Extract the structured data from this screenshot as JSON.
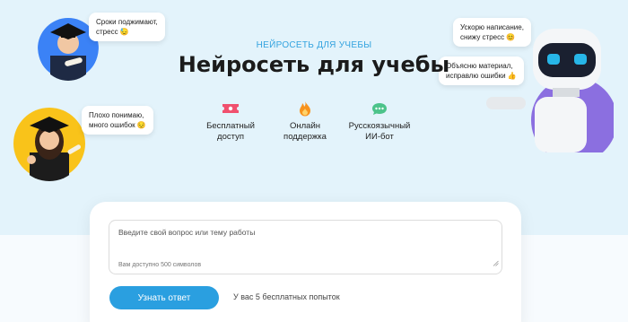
{
  "hero": {
    "eyebrow": "НЕЙРОСЕТЬ ДЛЯ УЧЕБЫ",
    "title": "Нейросеть для учебы"
  },
  "features": [
    {
      "icon": "ticket-icon",
      "label": "Бесплатный\nдоступ",
      "color": "#f0506e"
    },
    {
      "icon": "flame-icon",
      "label": "Онлайн\nподдержка",
      "color": "#f7931e"
    },
    {
      "icon": "chat-icon",
      "label": "Русскоязычный\nИИ-бот",
      "color": "#4cc38a"
    }
  ],
  "bubbles": {
    "student_male": "Сроки поджимают,\nстресс 😓",
    "student_female": "Плохо понимаю,\nмного ошибок 😔",
    "robot_top": "Ускорю написание,\nснижу стресс 😊",
    "robot_bottom": "Объясню материал,\nисправлю ошибки 👍"
  },
  "form": {
    "placeholder": "Введите свой вопрос или тему работы",
    "hint": "Вам доступно 500 символов",
    "submit_label": "Узнать ответ",
    "tries_text": "У вас 5 бесплатных попыток"
  },
  "colors": {
    "accent": "#2a9fe0",
    "hero_bg": "#e3f3fb",
    "circle_blue": "#3b82f6",
    "circle_yellow": "#f9c31a",
    "circle_purple": "#8b6fe0"
  }
}
